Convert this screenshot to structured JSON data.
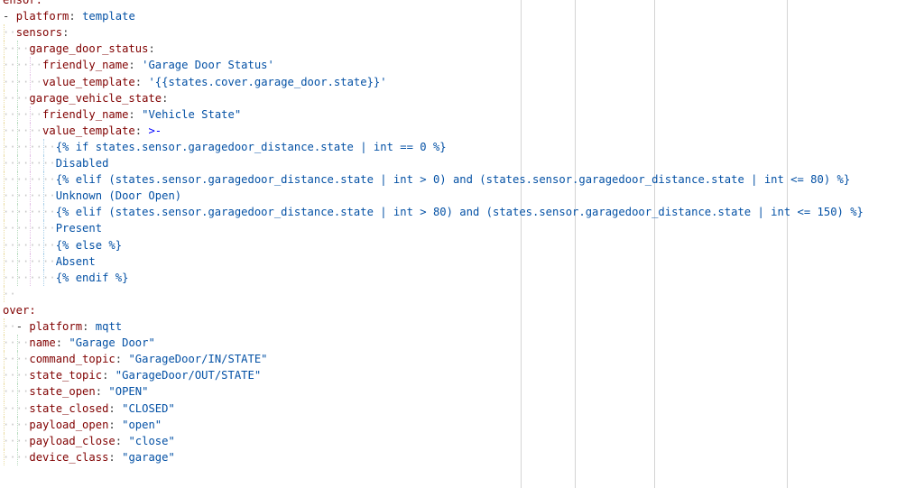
{
  "colors": {
    "background": "#ffffff",
    "key": "#800000",
    "string": "#0451a5",
    "template": "#0000ff",
    "punct": "#3c3c3c",
    "whitespace_dot": "#c8c8c8",
    "ruler": "#d4d4d4"
  },
  "lines": [
    {
      "indent": 0,
      "segments": [
        {
          "t": "ensor:",
          "c": "k"
        }
      ]
    },
    {
      "indent": 0,
      "segments": [
        {
          "t": "- ",
          "c": "p"
        },
        {
          "t": "platform",
          "c": "k"
        },
        {
          "t": ": ",
          "c": "p"
        },
        {
          "t": "template",
          "c": "s"
        }
      ]
    },
    {
      "indent": 2,
      "segments": [
        {
          "t": "sensors",
          "c": "k"
        },
        {
          "t": ":",
          "c": "p"
        }
      ]
    },
    {
      "indent": 4,
      "segments": [
        {
          "t": "garage_door_status",
          "c": "k"
        },
        {
          "t": ":",
          "c": "p"
        }
      ]
    },
    {
      "indent": 6,
      "segments": [
        {
          "t": "friendly_name",
          "c": "k"
        },
        {
          "t": ": ",
          "c": "p"
        },
        {
          "t": "'Garage Door Status'",
          "c": "s"
        }
      ]
    },
    {
      "indent": 6,
      "segments": [
        {
          "t": "value_template",
          "c": "k"
        },
        {
          "t": ": ",
          "c": "p"
        },
        {
          "t": "'{{states.cover.garage_door.state}}'",
          "c": "s"
        }
      ]
    },
    {
      "indent": 4,
      "segments": [
        {
          "t": "garage_vehicle_state",
          "c": "k"
        },
        {
          "t": ":",
          "c": "p"
        }
      ]
    },
    {
      "indent": 6,
      "segments": [
        {
          "t": "friendly_name",
          "c": "k"
        },
        {
          "t": ": ",
          "c": "p"
        },
        {
          "t": "\"Vehicle State\"",
          "c": "s"
        }
      ]
    },
    {
      "indent": 6,
      "segments": [
        {
          "t": "value_template",
          "c": "k"
        },
        {
          "t": ": ",
          "c": "p"
        },
        {
          "t": ">-",
          "c": "t"
        }
      ]
    },
    {
      "indent": 8,
      "segments": [
        {
          "t": "{% if states.sensor.garagedoor_distance.state | int == 0 %}",
          "c": "s"
        }
      ]
    },
    {
      "indent": 8,
      "segments": [
        {
          "t": "Disabled",
          "c": "s"
        }
      ]
    },
    {
      "indent": 8,
      "segments": [
        {
          "t": "{% elif (states.sensor.garagedoor_distance.state | int > 0) and (states.sensor.garagedoor_distance.state | int <= 80) %}",
          "c": "s"
        }
      ]
    },
    {
      "indent": 8,
      "segments": [
        {
          "t": "Unknown (Door Open)",
          "c": "s"
        }
      ]
    },
    {
      "indent": 8,
      "segments": [
        {
          "t": "{% elif (states.sensor.garagedoor_distance.state | int > 80) and (states.sensor.garagedoor_distance.state | int <= 150) %}",
          "c": "s"
        }
      ]
    },
    {
      "indent": 8,
      "segments": [
        {
          "t": "Present",
          "c": "s"
        }
      ]
    },
    {
      "indent": 8,
      "segments": [
        {
          "t": "{% else %}",
          "c": "s"
        }
      ]
    },
    {
      "indent": 8,
      "segments": [
        {
          "t": "Absent",
          "c": "s"
        }
      ]
    },
    {
      "indent": 8,
      "segments": [
        {
          "t": "{% endif %}",
          "c": "s"
        }
      ]
    },
    {
      "indent": 2,
      "segments": []
    },
    {
      "indent": 0,
      "segments": [
        {
          "t": "over:",
          "c": "k"
        }
      ]
    },
    {
      "indent": 2,
      "segments": [
        {
          "t": "- ",
          "c": "p"
        },
        {
          "t": "platform",
          "c": "k"
        },
        {
          "t": ": ",
          "c": "p"
        },
        {
          "t": "mqtt",
          "c": "s"
        }
      ]
    },
    {
      "indent": 4,
      "segments": [
        {
          "t": "name",
          "c": "k"
        },
        {
          "t": ": ",
          "c": "p"
        },
        {
          "t": "\"Garage Door\"",
          "c": "s"
        }
      ]
    },
    {
      "indent": 4,
      "segments": [
        {
          "t": "command_topic",
          "c": "k"
        },
        {
          "t": ": ",
          "c": "p"
        },
        {
          "t": "\"GarageDoor/IN/STATE\"",
          "c": "s"
        }
      ]
    },
    {
      "indent": 4,
      "segments": [
        {
          "t": "state_topic",
          "c": "k"
        },
        {
          "t": ": ",
          "c": "p"
        },
        {
          "t": "\"GarageDoor/OUT/STATE\"",
          "c": "s"
        }
      ]
    },
    {
      "indent": 4,
      "segments": [
        {
          "t": "state_open",
          "c": "k"
        },
        {
          "t": ": ",
          "c": "p"
        },
        {
          "t": "\"OPEN\"",
          "c": "s"
        }
      ]
    },
    {
      "indent": 4,
      "segments": [
        {
          "t": "state_closed",
          "c": "k"
        },
        {
          "t": ": ",
          "c": "p"
        },
        {
          "t": "\"CLOSED\"",
          "c": "s"
        }
      ]
    },
    {
      "indent": 4,
      "segments": [
        {
          "t": "payload_open",
          "c": "k"
        },
        {
          "t": ": ",
          "c": "p"
        },
        {
          "t": "\"open\"",
          "c": "s"
        }
      ]
    },
    {
      "indent": 4,
      "segments": [
        {
          "t": "payload_close",
          "c": "k"
        },
        {
          "t": ": ",
          "c": "p"
        },
        {
          "t": "\"close\"",
          "c": "s"
        }
      ]
    },
    {
      "indent": 4,
      "segments": [
        {
          "t": "device_class",
          "c": "k"
        },
        {
          "t": ": ",
          "c": "p"
        },
        {
          "t": "\"garage\"",
          "c": "s"
        }
      ]
    }
  ]
}
